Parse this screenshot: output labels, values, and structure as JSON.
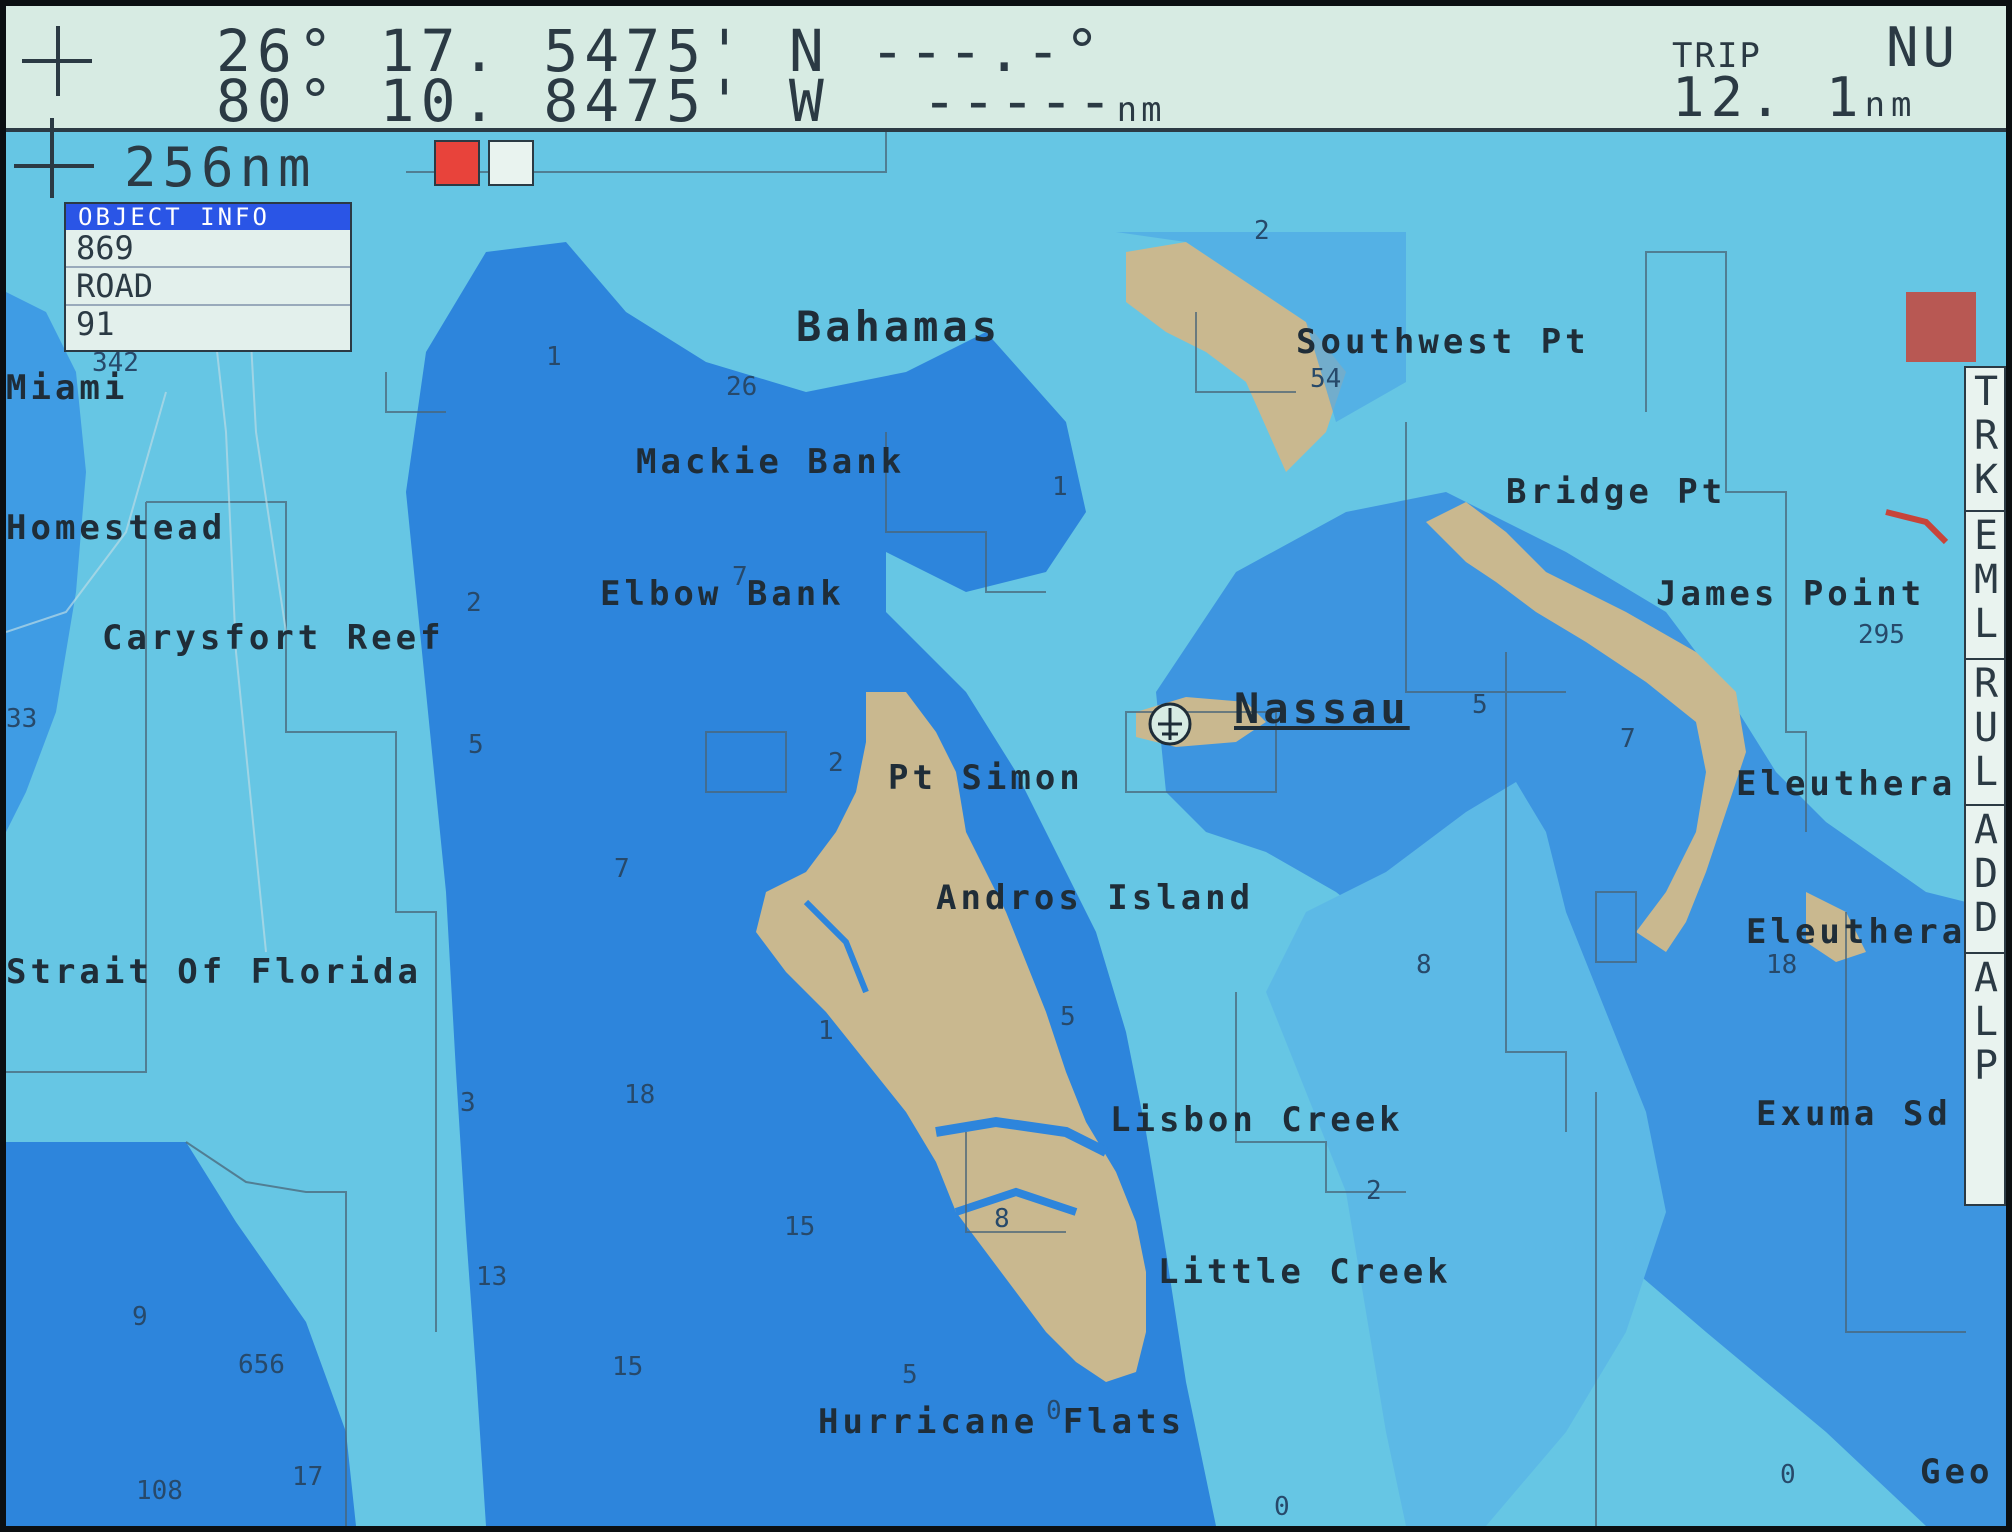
{
  "position": {
    "latitude": "26° 17. 5475' N",
    "longitude": "80° 10. 8475' W"
  },
  "bearing": "---.-°",
  "distance": {
    "value": "-----",
    "unit": "nm"
  },
  "trip": {
    "label": "TRIP",
    "value": "12. 1",
    "unit": "nm"
  },
  "orientation": "NU",
  "scale": {
    "value": "256",
    "unit": "nm"
  },
  "object_info": {
    "header": "OBJECT INFO",
    "rows": [
      "869",
      "ROAD",
      "91"
    ]
  },
  "side_menu": [
    "TRK",
    "EML",
    "RUL",
    "ADD",
    "ALP"
  ],
  "place_labels": [
    "Bahamas",
    "Southwest Pt",
    "Mackie Bank",
    "Bridge Pt",
    "Elbow Bank",
    "James Point",
    "Carysfort Reef",
    "Nassau",
    "Pt Simon",
    "Eleuthera",
    "Andros Island",
    "Eleuthera",
    "Strait Of Florida",
    "Lisbon Creek",
    "Exuma Sd",
    "Little Creek",
    "Hurricane Flats",
    "Miami",
    "Homestead",
    "Geo"
  ],
  "depth_soundings": [
    "1",
    "26",
    "2",
    "1",
    "342",
    "7",
    "2",
    "5",
    "2",
    "7",
    "5",
    "7",
    "1",
    "18",
    "3",
    "15",
    "13",
    "9",
    "656",
    "15",
    "5",
    "0",
    "17",
    "108",
    "5",
    "8",
    "18",
    "2",
    "54",
    "295",
    "33",
    "8",
    "0",
    "0"
  ],
  "colors": {
    "land": "#c9b88f",
    "shallow_water": "#66c6e4",
    "deep_water": "#2d85dc",
    "mid_water": "#4da8e6",
    "topbar": "#d7ebe3",
    "ink": "#2b3a44",
    "info_header": "#2a55e6",
    "alarm": "#e8433b"
  },
  "icons": [
    "cursor-cross-icon",
    "scale-cross-icon",
    "alarm-icon",
    "depth-icon",
    "airport-icon"
  ]
}
